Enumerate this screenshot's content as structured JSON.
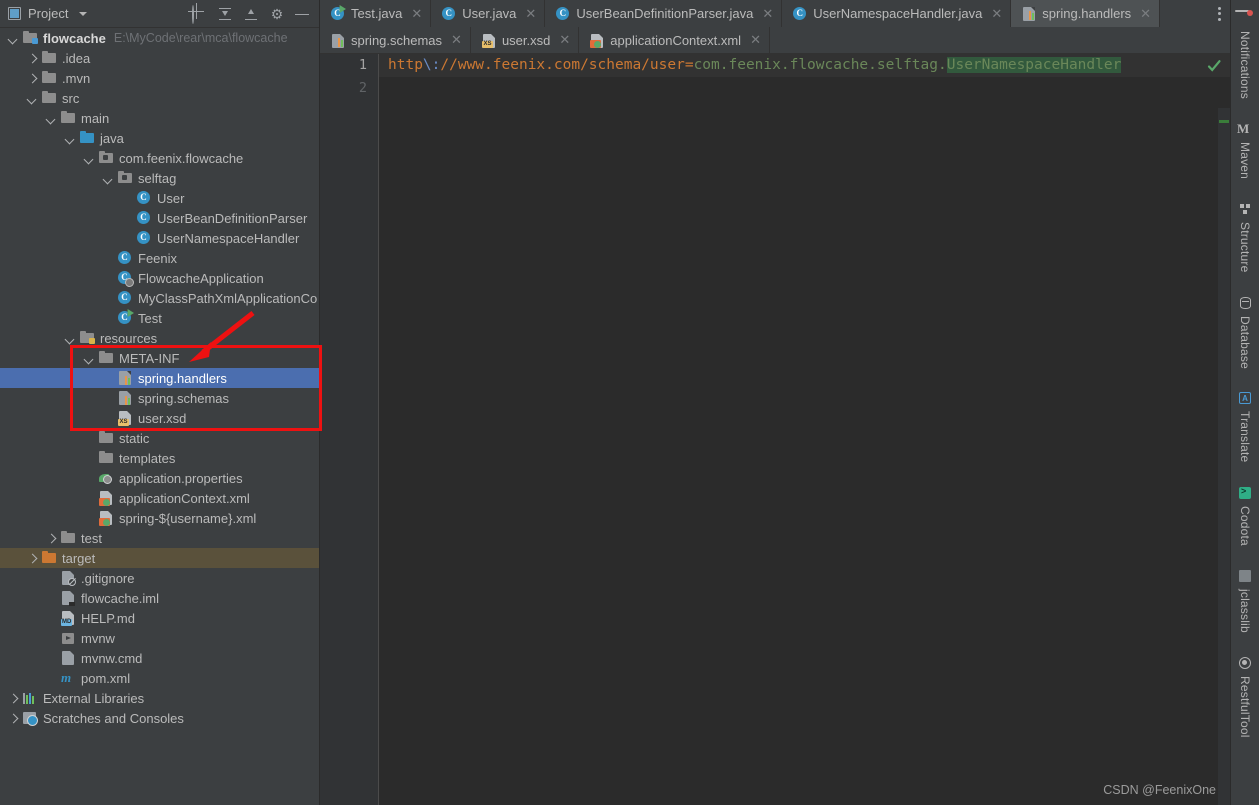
{
  "project_panel": {
    "title": "Project",
    "title_icon": "project-icon",
    "toolbar": [
      {
        "name": "locate-file-icon",
        "label": "Select Opened File"
      },
      {
        "name": "expand-all-icon",
        "label": "Expand All"
      },
      {
        "name": "collapse-all-icon",
        "label": "Collapse All"
      },
      {
        "name": "gear-icon",
        "label": "Options"
      },
      {
        "name": "minimize-icon",
        "label": "Hide"
      }
    ],
    "tree": [
      {
        "label": "flowcache",
        "path": "E:\\MyCode\\rear\\mca\\flowcache",
        "indent": 0,
        "twisty": "open",
        "icon": "module-folder-icon",
        "bold": true
      },
      {
        "label": ".idea",
        "indent": 1,
        "twisty": "closed",
        "icon": "folder-icon"
      },
      {
        "label": ".mvn",
        "indent": 1,
        "twisty": "closed",
        "icon": "folder-icon"
      },
      {
        "label": "src",
        "indent": 1,
        "twisty": "open",
        "icon": "folder-icon"
      },
      {
        "label": "main",
        "indent": 2,
        "twisty": "open",
        "icon": "folder-icon"
      },
      {
        "label": "java",
        "indent": 3,
        "twisty": "open",
        "icon": "source-root-folder-icon"
      },
      {
        "label": "com.feenix.flowcache",
        "indent": 4,
        "twisty": "open",
        "icon": "package-icon"
      },
      {
        "label": "selftag",
        "indent": 5,
        "twisty": "open",
        "icon": "package-icon"
      },
      {
        "label": "User",
        "indent": 6,
        "icon": "java-class-icon"
      },
      {
        "label": "UserBeanDefinitionParser",
        "indent": 6,
        "icon": "java-class-icon"
      },
      {
        "label": "UserNamespaceHandler",
        "indent": 6,
        "icon": "java-class-icon"
      },
      {
        "label": "Feenix",
        "indent": 5,
        "icon": "java-class-icon"
      },
      {
        "label": "FlowcacheApplication",
        "indent": 5,
        "icon": "spring-boot-class-icon"
      },
      {
        "label": "MyClassPathXmlApplicationCo",
        "indent": 5,
        "icon": "java-class-icon"
      },
      {
        "label": "Test",
        "indent": 5,
        "icon": "runnable-class-icon"
      },
      {
        "label": "resources",
        "indent": 3,
        "twisty": "open",
        "icon": "resource-root-folder-icon"
      },
      {
        "label": "META-INF",
        "indent": 4,
        "twisty": "open",
        "icon": "folder-icon"
      },
      {
        "label": "spring.handlers",
        "indent": 5,
        "icon": "properties-file-icon",
        "selected": true
      },
      {
        "label": "spring.schemas",
        "indent": 5,
        "icon": "properties-file-icon"
      },
      {
        "label": "user.xsd",
        "indent": 5,
        "icon": "xsd-file-icon"
      },
      {
        "label": "static",
        "indent": 4,
        "icon": "folder-icon"
      },
      {
        "label": "templates",
        "indent": 4,
        "icon": "folder-icon"
      },
      {
        "label": "application.properties",
        "indent": 4,
        "icon": "spring-properties-icon"
      },
      {
        "label": "applicationContext.xml",
        "indent": 4,
        "icon": "spring-xml-icon"
      },
      {
        "label": "spring-${username}.xml",
        "indent": 4,
        "icon": "spring-xml-icon"
      },
      {
        "label": "test",
        "indent": 2,
        "twisty": "closed",
        "icon": "folder-icon"
      },
      {
        "label": "target",
        "indent": 1,
        "twisty": "closed",
        "icon": "excluded-folder-icon",
        "excluded": true
      },
      {
        "label": ".gitignore",
        "indent": 2,
        "icon": "gitignore-file-icon"
      },
      {
        "label": "flowcache.iml",
        "indent": 2,
        "icon": "iml-file-icon"
      },
      {
        "label": "HELP.md",
        "indent": 2,
        "icon": "markdown-file-icon"
      },
      {
        "label": "mvnw",
        "indent": 2,
        "icon": "script-file-icon"
      },
      {
        "label": "mvnw.cmd",
        "indent": 2,
        "icon": "cmd-file-icon"
      },
      {
        "label": "pom.xml",
        "indent": 2,
        "icon": "maven-pom-icon"
      },
      {
        "label": "External Libraries",
        "indent": 0,
        "twisty": "closed",
        "icon": "libraries-icon"
      },
      {
        "label": "Scratches and Consoles",
        "indent": 0,
        "twisty": "closed",
        "icon": "scratches-icon"
      }
    ]
  },
  "editor": {
    "tab_rows": [
      [
        {
          "label": "Test.java",
          "icon": "runnable-class-icon",
          "closable": true,
          "active": false
        },
        {
          "label": "User.java",
          "icon": "java-class-icon",
          "closable": true,
          "active": false
        },
        {
          "label": "UserBeanDefinitionParser.java",
          "icon": "java-class-icon",
          "closable": true,
          "active": false
        },
        {
          "label": "UserNamespaceHandler.java",
          "icon": "java-class-icon",
          "closable": true,
          "active": false
        },
        {
          "label": "spring.handlers",
          "icon": "properties-file-icon",
          "closable": true,
          "active": true
        }
      ],
      [
        {
          "label": "spring.schemas",
          "icon": "properties-file-icon",
          "closable": true,
          "active": false
        },
        {
          "label": "user.xsd",
          "icon": "xsd-file-icon",
          "closable": true,
          "active": false
        },
        {
          "label": "applicationContext.xml",
          "icon": "spring-xml-icon",
          "closable": true,
          "active": false
        }
      ]
    ],
    "more_tabs_icon": "kebab-menu-icon",
    "line_numbers": [
      "1",
      "2"
    ],
    "current_line": "1",
    "code_line_1": {
      "key": "http",
      "escape": "\\:",
      "key_tail": "//www.feenix.com/schema/user",
      "equals": "=",
      "value_head": "com.feenix.flowcache.selftag.",
      "value_highlight": "UserNamespaceHandler"
    },
    "inspection_icon": "green-check-icon",
    "watermark": "CSDN @FeenixOne"
  },
  "right_toolbar": [
    {
      "label": "Notifications",
      "icon": "bell-icon",
      "badge": true
    },
    {
      "label": "Maven",
      "icon": "maven-icon"
    },
    {
      "label": "Structure",
      "icon": "structure-icon"
    },
    {
      "label": "Database",
      "icon": "database-icon"
    },
    {
      "label": "Translate",
      "icon": "translate-icon"
    },
    {
      "label": "Codota",
      "icon": "codota-icon"
    },
    {
      "label": "jclasslib",
      "icon": "jclasslib-icon"
    },
    {
      "label": "RestfulTool",
      "icon": "restful-tool-icon"
    }
  ],
  "annotation": {
    "box_color": "#ee1111",
    "arrow_color": "#ee1111"
  },
  "colors": {
    "panel_bg": "#3c3f41",
    "editor_bg": "#2b2b2b",
    "selection_blue": "#4b6eaf",
    "excluded_bg": "#5a513b",
    "accent_orange": "#cc7832",
    "accent_green": "#6a8759"
  }
}
